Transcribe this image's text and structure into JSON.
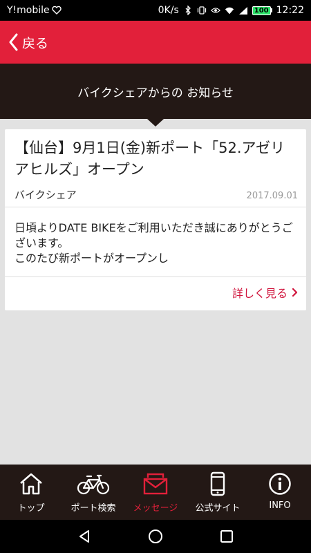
{
  "status_bar": {
    "carrier": "Y!mobile",
    "net_speed": "0K/s",
    "battery": "100",
    "time": "12:22"
  },
  "header": {
    "back_label": "戻る"
  },
  "band": {
    "title": "バイクシェアからの お知らせ"
  },
  "notice": {
    "title": "【仙台】9月1日(金)新ポート「52.アゼリアヒルズ」オープン",
    "source": "バイクシェア",
    "date": "2017.09.01",
    "body": "日頃よりDATE BIKEをご利用いただき誠にありがとうございます。\nこのたび新ポートがオープンし",
    "more_label": "詳しく見る"
  },
  "tabs": [
    {
      "label": "トップ",
      "icon": "home-icon"
    },
    {
      "label": "ポート検索",
      "icon": "bicycle-icon"
    },
    {
      "label": "メッセージ",
      "icon": "envelope-icon",
      "active": true
    },
    {
      "label": "公式サイト",
      "icon": "smartphone-icon"
    },
    {
      "label": "INFO",
      "icon": "info-icon"
    }
  ],
  "colors": {
    "accent": "#e2203a",
    "band": "#231815",
    "link": "#d0143c"
  }
}
